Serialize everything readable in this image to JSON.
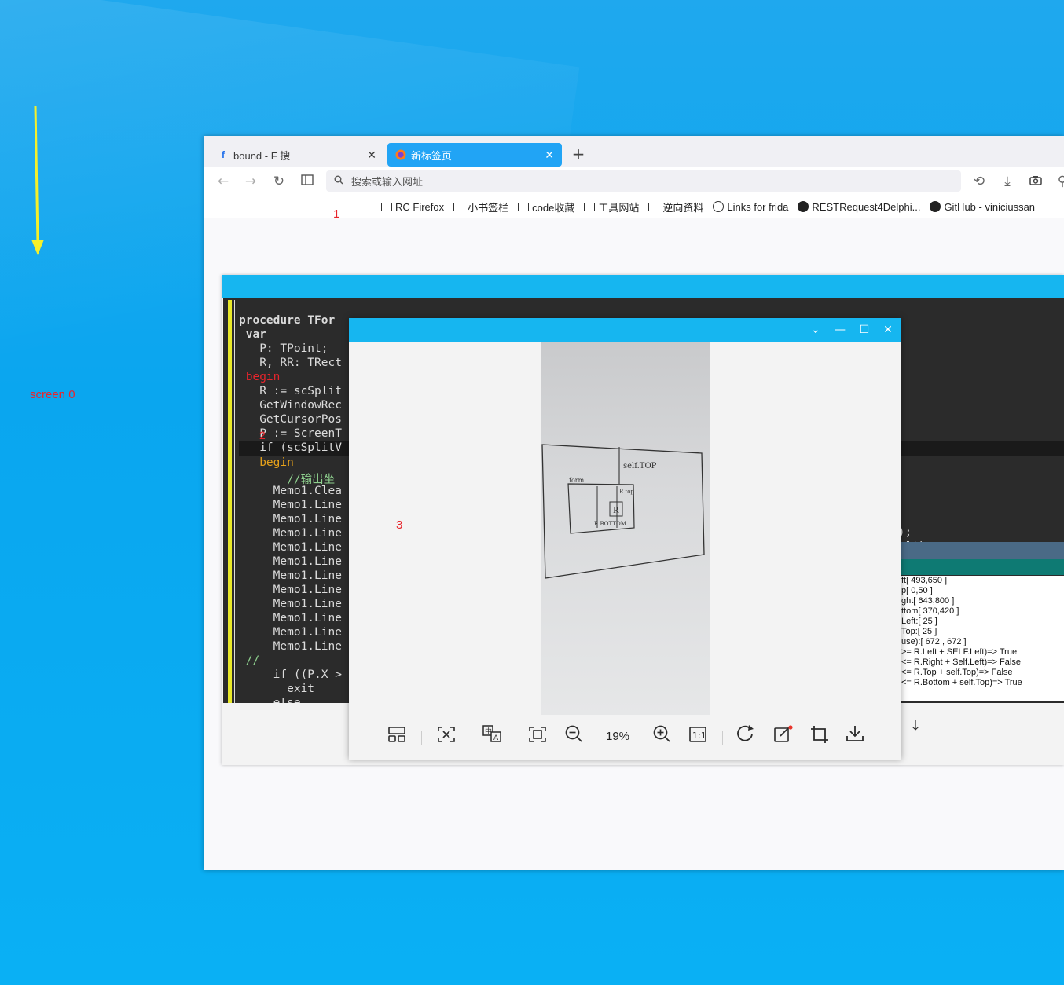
{
  "desktop": {
    "label": "screen 0"
  },
  "browser": {
    "tabs": [
      {
        "title": "bound - F 搜",
        "favicon": "F"
      },
      {
        "title": "新标签页",
        "favicon": "firefox"
      }
    ],
    "url_placeholder": "搜索或输入网址",
    "bookmarks": [
      {
        "label": "RC Firefox",
        "icon": "folder-icon"
      },
      {
        "label": "小书签栏",
        "icon": "folder-icon"
      },
      {
        "label": "code收藏",
        "icon": "folder-icon"
      },
      {
        "label": "工具网站",
        "icon": "folder-icon"
      },
      {
        "label": "逆向资料",
        "icon": "folder-icon"
      },
      {
        "label": "Links for frida",
        "icon": "globe-icon"
      },
      {
        "label": "RESTRequest4Delphi...",
        "icon": "github-icon"
      },
      {
        "label": "GitHub - viniciussan",
        "icon": "github-icon"
      }
    ],
    "marker": "1"
  },
  "code_editor": {
    "marker": "2",
    "lines": [
      "procedure TFor",
      " var",
      "   P: TPoint;",
      "   R, RR: TRect",
      " begin",
      "   R := scSplit",
      "   GetWindowRec",
      "   GetCursorPos",
      "   P := ScreenT",
      "   if (scSplitV",
      "   begin",
      "       //输出坐",
      "     Memo1.Clea",
      "     Memo1.Line",
      "     Memo1.Line",
      "     Memo1.Line",
      "     Memo1.Line",
      "     Memo1.Line",
      "     Memo1.Line",
      "     Memo1.Line",
      "     Memo1.Line",
      "     Memo1.Line",
      "     Memo1.Line",
      "     Memo1.Line",
      " //",
      "     if ((P.X >",
      "       exit",
      "     else"
    ],
    "right_fragments": [
      "');",
      "' ]');"
    ],
    "memo_lines": [
      "ft[ 493,650 ]",
      "p[ 0,50 ]",
      "ght[ 643,800 ]",
      "ttom[ 370,420 ]",
      "Left:[ 25 ]",
      "Top:[ 25 ]",
      "use):[ 672 , 672 ]",
      ">= R.Left + SELF.Left)=> True",
      "<= R.Right + Self.Left)=> False",
      "<= R.Top + self.Top)=> False",
      "<= R.Bottom + self.Top)=> True"
    ]
  },
  "viewer": {
    "marker": "3",
    "zoom": "19%",
    "photo_notes": [
      "self.TOP",
      "form",
      "R.top",
      "R",
      "R.BOTTOM"
    ],
    "toolbar": [
      "gallery-icon",
      "fit-icon",
      "translate-icon",
      "fullscreen-icon",
      "zoom-out-icon",
      "zoom-in-icon",
      "actual-size-icon",
      "rotate-icon",
      "edit-icon",
      "crop-icon",
      "download-icon"
    ]
  },
  "colors": {
    "desktop": "#0aa6ef",
    "titlebar": "#16b6f0",
    "tab_active": "#21a4f5",
    "marker": "#e8252c"
  }
}
